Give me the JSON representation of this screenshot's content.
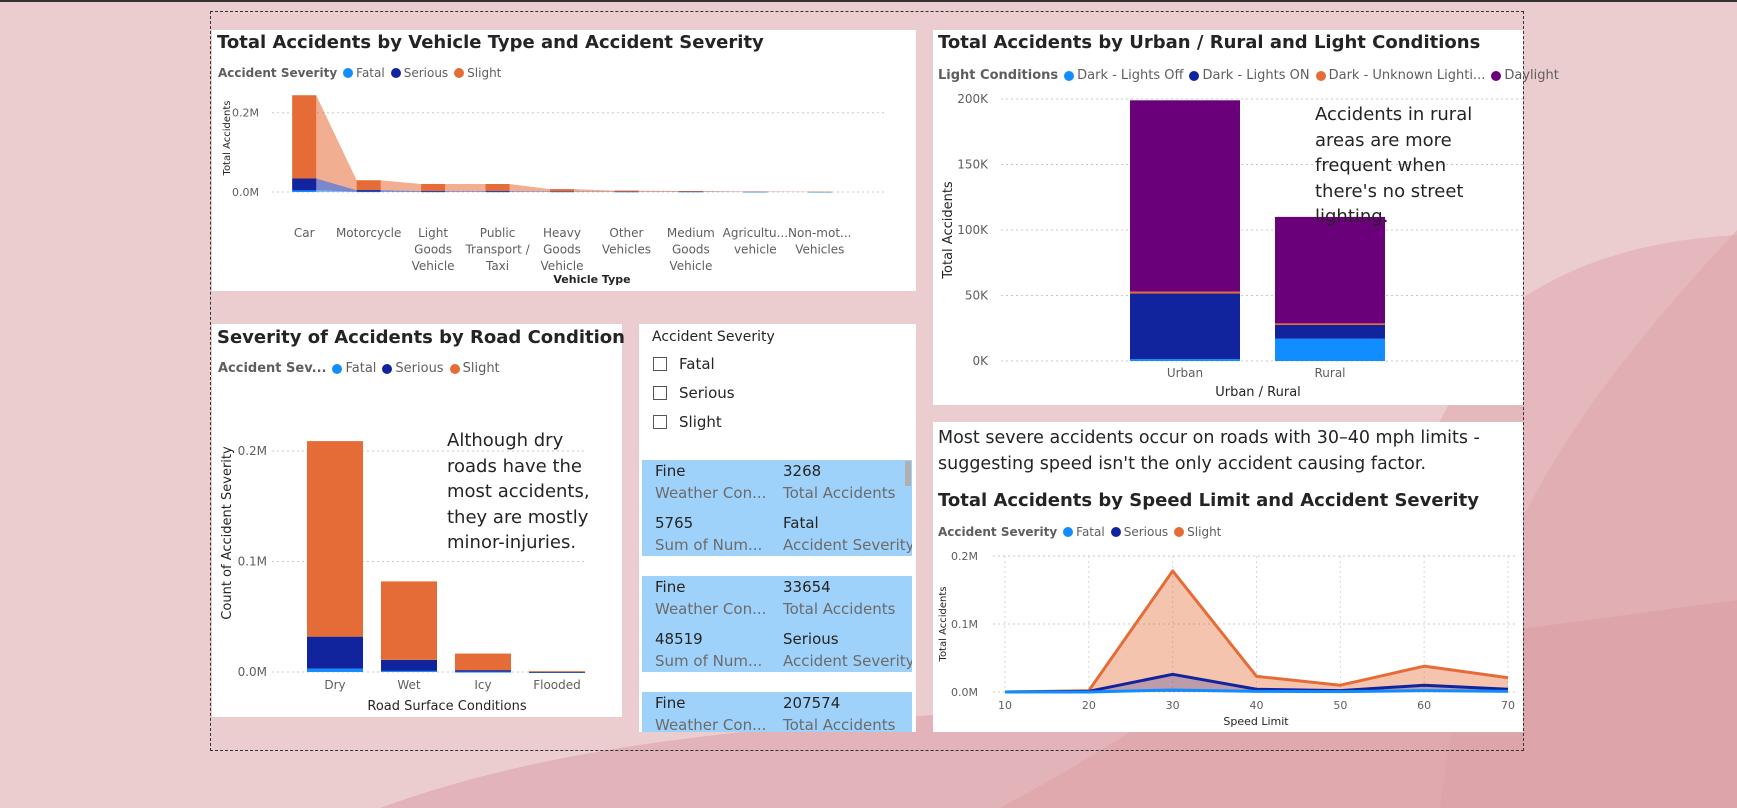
{
  "colors": {
    "fatal": "#118dff",
    "serious": "#12239e",
    "slight": "#e66c37",
    "dark_off": "#118dff",
    "dark_on": "#12239e",
    "dark_unknown": "#e66c37",
    "daylight": "#6b007b",
    "card_blue": "#9fd2fb"
  },
  "vehicle_chart": {
    "title": "Total Accidents by Vehicle Type and Accident Severity",
    "legend_title": "Accident Severity",
    "legend": [
      "Fatal",
      "Serious",
      "Slight"
    ],
    "ylabel": "Total Accidents",
    "xlabel": "Vehicle Type",
    "yticks": [
      "0.2M",
      "0.0M"
    ]
  },
  "light_chart": {
    "title": "Total Accidents by Urban / Rural and Light Conditions",
    "legend_title": "Light Conditions",
    "legend": [
      "Dark - Lights Off",
      "Dark - Lights ON",
      "Dark - Unknown Lighti...",
      "Daylight"
    ],
    "ylabel": "Total Accidents",
    "xlabel": "Urban / Rural",
    "yticks": [
      "200K",
      "150K",
      "100K",
      "50K",
      "0K"
    ],
    "annotation": "Accidents in rural areas are more frequent when there's no street lighting."
  },
  "road_chart": {
    "title": "Severity of Accidents by Road Condition",
    "legend_title": "Accident Sev...",
    "legend": [
      "Fatal",
      "Serious",
      "Slight"
    ],
    "ylabel": "Count of Accident Severity",
    "xlabel": "Road Surface Conditions",
    "yticks": [
      "0.2M",
      "0.1M",
      "0.0M"
    ],
    "annotation": "Although dry roads have the most accidents, they are mostly minor-injuries."
  },
  "slicer": {
    "title": "Accident Severity",
    "options": [
      "Fatal",
      "Serious",
      "Slight"
    ]
  },
  "multirow_cards": [
    {
      "weather": "Fine",
      "weather_label": "Weather Con...",
      "total": "3268",
      "total_label": "Total Accidents",
      "sum": "5765",
      "sum_label": "Sum of Num...",
      "severity": "Fatal",
      "severity_label": "Accident Severity"
    },
    {
      "weather": "Fine",
      "weather_label": "Weather Con...",
      "total": "33654",
      "total_label": "Total Accidents",
      "sum": "48519",
      "sum_label": "Sum of Num...",
      "severity": "Serious",
      "severity_label": "Accident Severity"
    },
    {
      "weather": "Fine",
      "weather_label": "Weather Con...",
      "total": "207574",
      "total_label": "Total Accidents"
    }
  ],
  "speed_chart": {
    "insight": "Most severe accidents occur on roads with 30–40 mph limits - suggesting speed isn't the only accident causing factor.",
    "title": "Total Accidents by Speed Limit and Accident Severity",
    "legend_title": "Accident Severity",
    "legend": [
      "Fatal",
      "Serious",
      "Slight"
    ],
    "ylabel": "Total Accidents",
    "xlabel": "Speed Limit",
    "yticks": [
      "0.2M",
      "0.1M",
      "0.0M"
    ]
  },
  "chart_data": [
    {
      "type": "area",
      "title": "Total Accidents by Vehicle Type and Accident Severity",
      "xlabel": "Vehicle Type",
      "ylabel": "Total Accidents",
      "ylim": [
        0,
        0.27
      ],
      "unit": "M",
      "categories": [
        "Car",
        "Motorcycle",
        "Light Goods Vehicle",
        "Public Transport / Taxi",
        "Heavy Goods Vehicle",
        "Other Vehicles",
        "Medium Goods Vehicle",
        "Agricultu... vehicle",
        "Non-mot... Vehicles"
      ],
      "series": [
        {
          "name": "Fatal",
          "values": [
            0.004,
            0.0005,
            0.0003,
            0.0002,
            0.0002,
            0.0001,
            0.0001,
            0.0,
            0.0
          ]
        },
        {
          "name": "Serious",
          "values": [
            0.03,
            0.004,
            0.002,
            0.002,
            0.001,
            0.0005,
            0.0005,
            0.0002,
            0.0001
          ]
        },
        {
          "name": "Slight",
          "values": [
            0.21,
            0.025,
            0.018,
            0.018,
            0.006,
            0.003,
            0.002,
            0.001,
            0.0005
          ]
        }
      ],
      "grid": true,
      "legend_position": "top-left"
    },
    {
      "type": "bar",
      "stacked": true,
      "title": "Total Accidents by Urban / Rural and Light Conditions",
      "xlabel": "Urban / Rural",
      "ylabel": "Total Accidents",
      "ylim": [
        0,
        200000
      ],
      "categories": [
        "Urban",
        "Rural"
      ],
      "series": [
        {
          "name": "Dark - Lights Off",
          "values": [
            1500,
            17000
          ]
        },
        {
          "name": "Dark - Lights ON",
          "values": [
            50000,
            10500
          ]
        },
        {
          "name": "Dark - Unknown Lighti...",
          "values": [
            1500,
            1200
          ]
        },
        {
          "name": "Daylight",
          "values": [
            146000,
            81300
          ]
        }
      ],
      "grid": true,
      "legend_position": "top-left"
    },
    {
      "type": "bar",
      "stacked": true,
      "title": "Severity of Accidents by Road Condition",
      "xlabel": "Road Surface Conditions",
      "ylabel": "Count of Accident Severity",
      "ylim": [
        0,
        0.21
      ],
      "unit": "M",
      "categories": [
        "Dry",
        "Wet",
        "Icy",
        "Flooded"
      ],
      "series": [
        {
          "name": "Fatal",
          "values": [
            0.003,
            0.001,
            0.0002,
            0.0
          ]
        },
        {
          "name": "Serious",
          "values": [
            0.029,
            0.01,
            0.0015,
            0.0001
          ]
        },
        {
          "name": "Slight",
          "values": [
            0.177,
            0.071,
            0.015,
            0.0007
          ]
        }
      ],
      "grid": true,
      "legend_position": "top-left"
    },
    {
      "type": "area",
      "title": "Total Accidents by Speed Limit and Accident Severity",
      "xlabel": "Speed Limit",
      "ylabel": "Total Accidents",
      "ylim": [
        0,
        0.2
      ],
      "unit": "M",
      "x": [
        10,
        20,
        30,
        40,
        50,
        60,
        70
      ],
      "series": [
        {
          "name": "Fatal",
          "values": [
            0.0,
            0.0,
            0.003,
            0.001,
            0.0005,
            0.002,
            0.001
          ]
        },
        {
          "name": "Serious",
          "values": [
            0.0,
            0.001,
            0.026,
            0.004,
            0.002,
            0.01,
            0.004
          ]
        },
        {
          "name": "Slight",
          "values": [
            0.0,
            0.002,
            0.178,
            0.023,
            0.01,
            0.038,
            0.021
          ]
        }
      ],
      "grid": true,
      "legend_position": "top-left"
    }
  ]
}
